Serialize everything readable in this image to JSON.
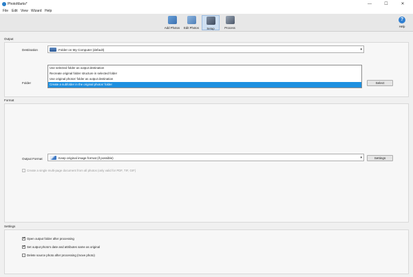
{
  "window": {
    "title": "PhotoMarks*",
    "minimize": "—",
    "maximize": "☐",
    "close": "✕"
  },
  "menu": [
    "File",
    "Edit",
    "View",
    "Wizard",
    "Help"
  ],
  "toolbar": {
    "add_photos": "Add Photos",
    "edit_photos": "Edit Photos",
    "setup": "Setup",
    "process": "Process",
    "help": "Help",
    "help_glyph": "?"
  },
  "output": {
    "section": "Output",
    "destination_label": "Destination",
    "destination_value": "Folder on My Computer (default)",
    "folder_label": "Folder",
    "folder_options": [
      "Use selected folder as output destination",
      "Recreate original folder structure in selected folder",
      "Use original photos' folder as output destination",
      "Create a subfolder in the original photos' folder"
    ],
    "selected_folder_option": 3,
    "select_button": "Select"
  },
  "format": {
    "section": "Format",
    "output_format_label": "Output Format",
    "output_format_value": "Keep original image format (if possible)",
    "settings_button": "Settings",
    "multipage_label": "Create a single multi-page document from all photos (only valid for PDF, TIF, GIF)",
    "multipage_checked": false,
    "multipage_enabled": false
  },
  "settings": {
    "section": "Settings",
    "items": [
      {
        "label": "Open output folder after processing",
        "checked": true
      },
      {
        "label": "Set output photo's date and attributes same as original",
        "checked": true
      },
      {
        "label": "Delete source photo after processing (move photo)",
        "checked": false
      }
    ]
  },
  "glyphs": {
    "caret": "▾",
    "check": "✔"
  }
}
